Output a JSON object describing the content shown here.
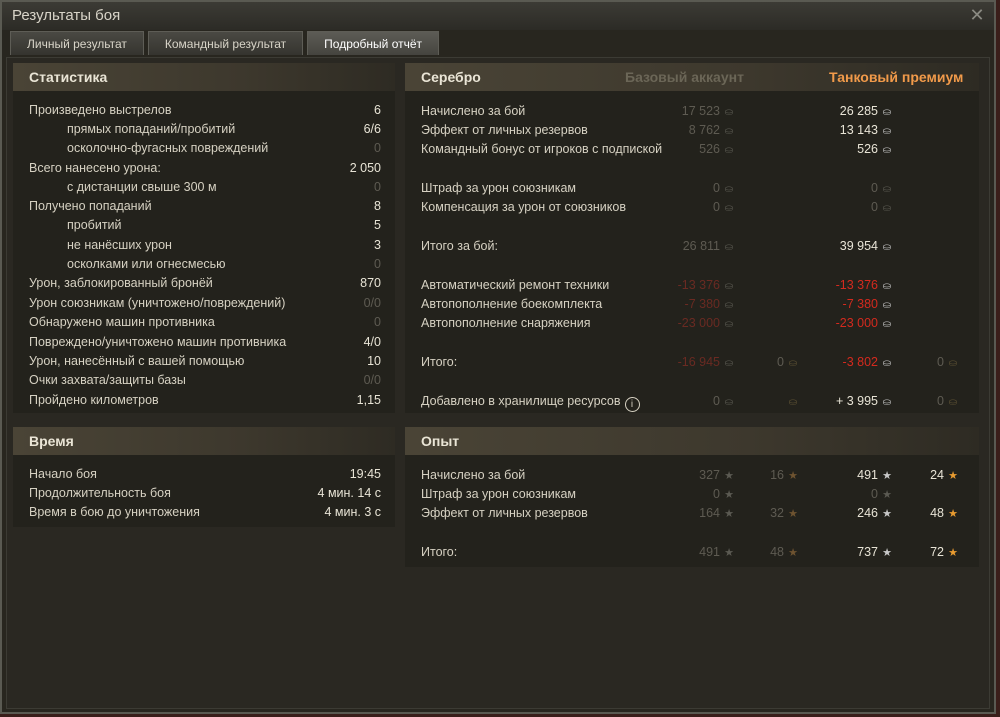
{
  "window": {
    "title": "Результаты боя",
    "close": "✕"
  },
  "tabs": [
    "Личный результат",
    "Командный результат",
    "Подробный отчёт"
  ],
  "stats": {
    "header": "Статистика",
    "rows": [
      {
        "label": "Произведено выстрелов",
        "value": "6"
      },
      {
        "label": "прямых попаданий/пробитий",
        "value": "6/6"
      },
      {
        "label": "осколочно-фугасных повреждений",
        "value": "0"
      },
      {
        "label": "Всего нанесено урона:",
        "value": "2 050"
      },
      {
        "label": "с дистанции свыше 300 м",
        "value": "0"
      },
      {
        "label": "Получено попаданий",
        "value": "8"
      },
      {
        "label": "пробитий",
        "value": "5"
      },
      {
        "label": "не нанёсших урон",
        "value": "3"
      },
      {
        "label": "осколками или огнесмесью",
        "value": "0"
      },
      {
        "label": "Урон, заблокированный бронёй",
        "value": "870"
      },
      {
        "label": "Урон союзникам (уничтожено/повреждений)",
        "value": "0/0"
      },
      {
        "label": "Обнаружено машин противника",
        "value": "0"
      },
      {
        "label": "Повреждено/уничтожено машин противника",
        "value": "4/0"
      },
      {
        "label": "Урон, нанесённый с вашей помощью",
        "value": "10"
      },
      {
        "label": "Очки захвата/защиты базы",
        "value": "0/0"
      },
      {
        "label": "Пройдено километров",
        "value": "1,15"
      }
    ]
  },
  "time": {
    "header": "Время",
    "rows": [
      {
        "label": "Начало боя",
        "value": "19:45"
      },
      {
        "label": "Продолжительность боя",
        "value": "4 мин. 14 с"
      },
      {
        "label": "Время в бою до уничтожения",
        "value": "4 мин. 3 с"
      }
    ]
  },
  "silver": {
    "header": "Серебро",
    "col_base": "Базовый аккаунт",
    "col_premium": "Танковый премиум",
    "rows": [
      {
        "label": "Начислено за бой",
        "base": "17 523",
        "prem": "26 285"
      },
      {
        "label": "Эффект от личных резервов",
        "base": "8 762",
        "prem": "13 143"
      },
      {
        "label": "Командный бонус от игроков с подпиской",
        "base": "526",
        "prem": "526"
      },
      {
        "label": "Штраф за урон союзникам",
        "base": "0",
        "prem": "0"
      },
      {
        "label": "Компенсация за урон от союзников",
        "base": "0",
        "prem": "0"
      },
      {
        "label": "Итого за бой:",
        "base": "26 811",
        "prem": "39 954"
      },
      {
        "label": "Автоматический ремонт техники",
        "base": "-13 376",
        "prem": "-13 376"
      },
      {
        "label": "Автопополнение боекомплекта",
        "base": "-7 380",
        "prem": "-7 380"
      },
      {
        "label": "Автопополнение снаряжения",
        "base": "-23 000",
        "prem": "-23 000"
      },
      {
        "label": "Итого:",
        "base": "-16 945",
        "base_gold": "0",
        "prem": "-3 802",
        "prem_gold": "0"
      },
      {
        "label": "Добавлено в хранилище ресурсов",
        "base": "0",
        "prem": "+ 3 995",
        "prem_gold": "0"
      }
    ]
  },
  "xp": {
    "header": "Опыт",
    "rows": [
      {
        "label": "Начислено за бой",
        "base": "327",
        "base_free": "16",
        "prem": "491",
        "prem_free": "24"
      },
      {
        "label": "Штраф за урон союзникам",
        "base": "0",
        "prem": "0"
      },
      {
        "label": "Эффект от личных резервов",
        "base": "164",
        "base_free": "32",
        "prem": "246",
        "prem_free": "48"
      },
      {
        "label": "Итого:",
        "base": "491",
        "base_free": "48",
        "prem": "737",
        "prem_free": "72"
      }
    ]
  },
  "icons": {
    "silver": "coin-icon",
    "gold": "gold-icon",
    "xp": "star-icon",
    "free_xp": "free-xp-star-icon",
    "info": "i"
  },
  "colors": {
    "accent": "#f19a4a",
    "negative": "#d42a1e"
  }
}
